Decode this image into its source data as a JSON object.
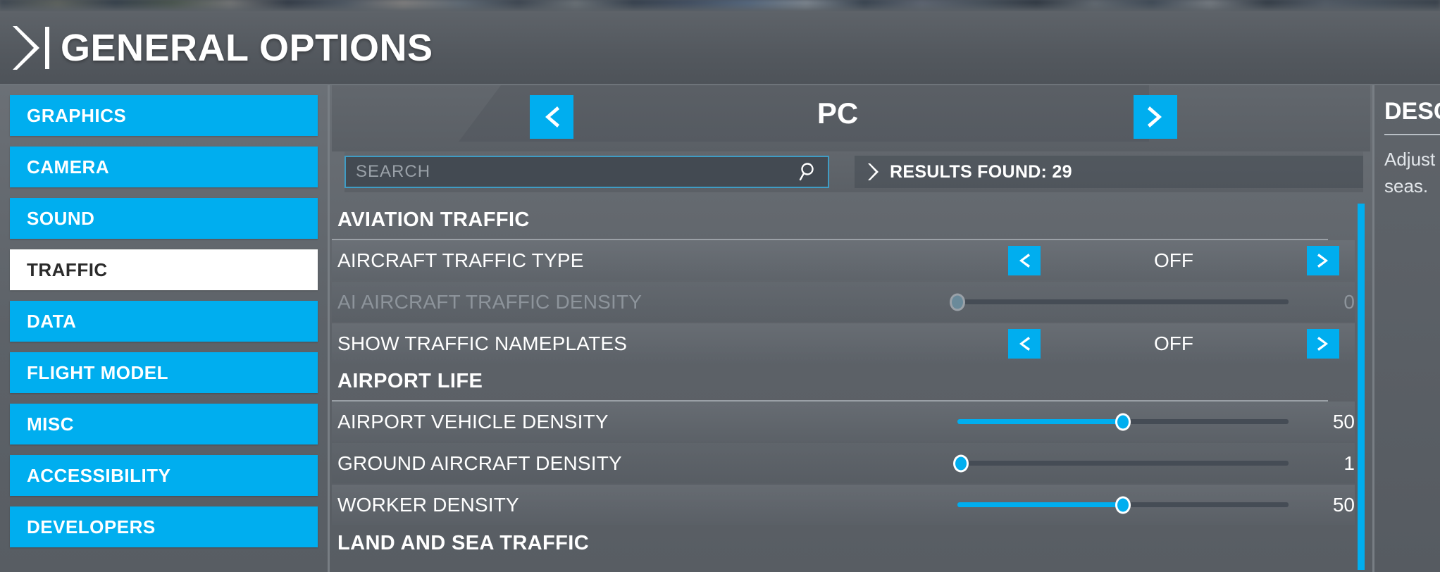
{
  "header": {
    "title": "GENERAL OPTIONS",
    "chevron_icon": "chevron-right-icon"
  },
  "sidebar": {
    "items": [
      {
        "label": "GRAPHICS",
        "selected": false
      },
      {
        "label": "CAMERA",
        "selected": false
      },
      {
        "label": "SOUND",
        "selected": false
      },
      {
        "label": "TRAFFIC",
        "selected": true
      },
      {
        "label": "DATA",
        "selected": false
      },
      {
        "label": "FLIGHT MODEL",
        "selected": false
      },
      {
        "label": "MISC",
        "selected": false
      },
      {
        "label": "ACCESSIBILITY",
        "selected": false
      },
      {
        "label": "DEVELOPERS",
        "selected": false
      }
    ]
  },
  "platform_selector": {
    "prev_icon": "chevron-left-icon",
    "next_icon": "chevron-right-icon",
    "current": "PC"
  },
  "search": {
    "placeholder": "SEARCH",
    "value": "",
    "icon": "search-icon",
    "results_chevron_icon": "chevron-right-icon",
    "results_label": "RESULTS FOUND: 29"
  },
  "settings": {
    "sections": [
      {
        "title": "AVIATION TRAFFIC",
        "rows": [
          {
            "label": "AIRCRAFT TRAFFIC TYPE",
            "control": "spinner",
            "value": "OFF",
            "disabled": false,
            "prev_icon": "chevron-left-icon",
            "next_icon": "chevron-right-icon"
          },
          {
            "label": "AI AIRCRAFT TRAFFIC DENSITY",
            "control": "slider",
            "value": "0",
            "percent": 0,
            "disabled": true
          },
          {
            "label": "SHOW TRAFFIC NAMEPLATES",
            "control": "spinner",
            "value": "OFF",
            "disabled": false,
            "prev_icon": "chevron-left-icon",
            "next_icon": "chevron-right-icon"
          }
        ]
      },
      {
        "title": "AIRPORT LIFE",
        "rows": [
          {
            "label": "AIRPORT VEHICLE DENSITY",
            "control": "slider",
            "value": "50",
            "percent": 50,
            "disabled": false
          },
          {
            "label": "GROUND AIRCRAFT DENSITY",
            "control": "slider",
            "value": "1",
            "percent": 1,
            "disabled": false
          },
          {
            "label": "WORKER DENSITY",
            "control": "slider",
            "value": "50",
            "percent": 50,
            "disabled": false
          }
        ]
      },
      {
        "title": "LAND AND SEA TRAFFIC",
        "rows": []
      }
    ]
  },
  "description": {
    "title": "DESCRIPTION",
    "body_line1": "Adjust",
    "body_line2": "seas."
  },
  "colors": {
    "accent": "#00AEEF",
    "panel": "#5b6066",
    "selected_text": "#2b2b2b"
  }
}
